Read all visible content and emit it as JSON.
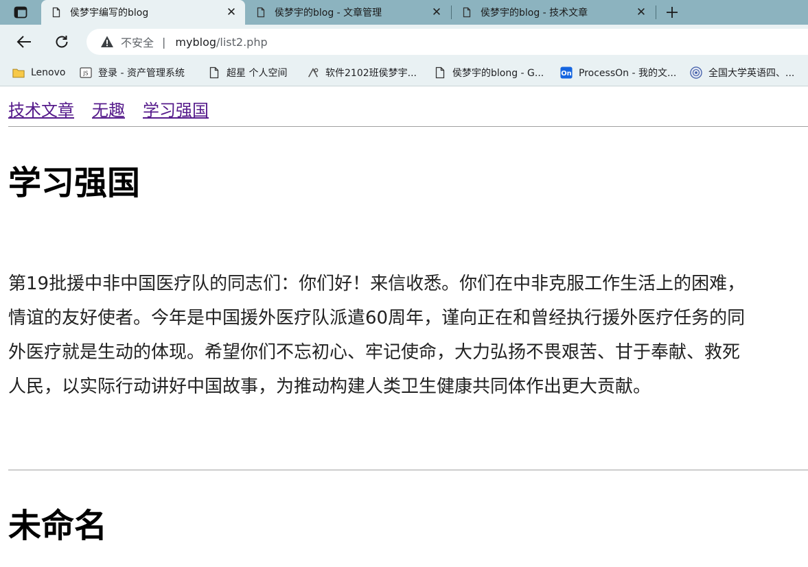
{
  "browser": {
    "tabs": [
      {
        "title": "侯梦宇编写的blog",
        "active": true
      },
      {
        "title": "侯梦宇的blog - 文章管理",
        "active": false
      },
      {
        "title": "侯梦宇的blog - 技术文章",
        "active": false
      }
    ],
    "address": {
      "insecure_label": "不安全",
      "separator": "|",
      "host": "myblog",
      "path": "/list2.php"
    },
    "bookmarks": [
      {
        "label": "Lenovo",
        "icon": "folder-icon"
      },
      {
        "label": "登录 - 资产管理系统",
        "icon": "js-file-icon"
      },
      {
        "label": "超星 个人空间",
        "icon": "page-icon"
      },
      {
        "label": "软件2102班侯梦宇...",
        "icon": "tool-icon"
      },
      {
        "label": "侯梦宇的blong - G...",
        "icon": "page-icon"
      },
      {
        "label": "ProcessOn - 我的文...",
        "icon": "processon-icon"
      },
      {
        "label": "全国大学英语四、...",
        "icon": "emblem-icon"
      }
    ]
  },
  "page": {
    "nav_links": [
      "技术文章",
      "无趣",
      "学习强国"
    ],
    "articles": [
      {
        "title": "学习强国",
        "body_lines": [
          "第19批援中非中国医疗队的同志们：你们好！来信收悉。你们在中非克服工作生活上的困难，",
          "情谊的友好使者。今年是中国援外医疗队派遣60周年，谨向正在和曾经执行援外医疗任务的同",
          "外医疗就是生动的体现。希望你们不忘初心、牢记使命，大力弘扬不畏艰苦、甘于奉献、救死",
          "人民，以实际行动讲好中国故事，为推动构建人类卫生健康共同体作出更大贡献。"
        ]
      },
      {
        "title": "未命名"
      }
    ]
  },
  "colors": {
    "tabstrip": "#8cb3bf",
    "toolbar": "#e9f1f3",
    "visited_link": "#551a8b"
  }
}
